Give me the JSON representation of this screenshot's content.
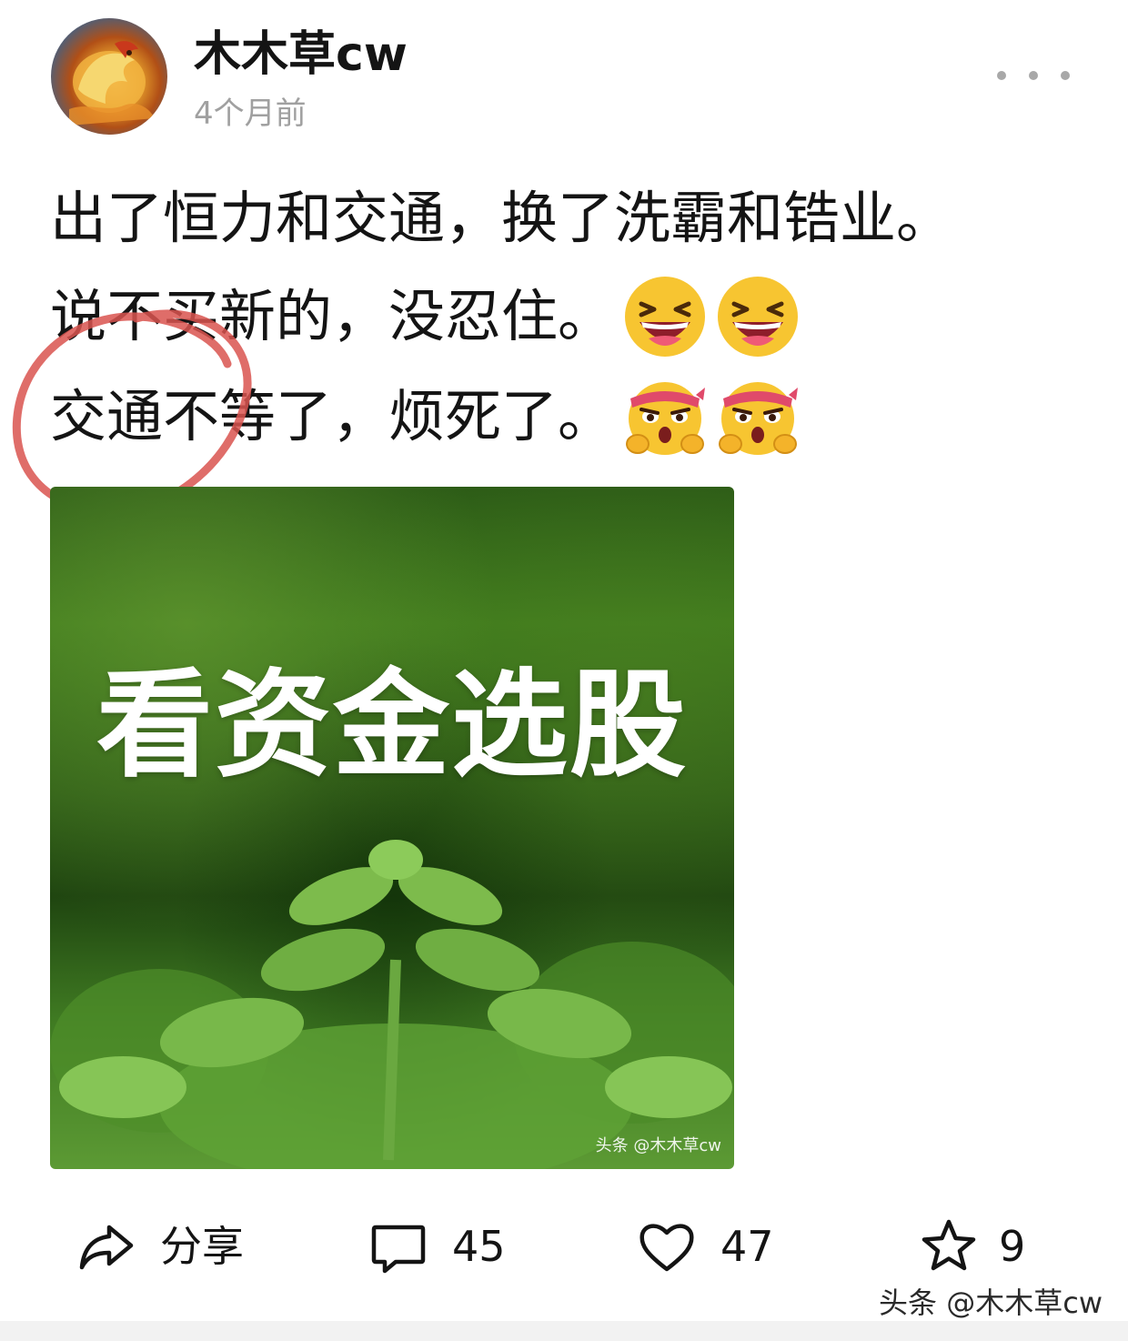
{
  "header": {
    "username": "木木草cw",
    "timestamp": "4个月前",
    "more_icon": "more-dots-icon"
  },
  "post": {
    "lines": [
      {
        "text": "出了恒力和交通，换了洗霸和锆业。",
        "emojis": []
      },
      {
        "text": "说不买新的，没忍住。",
        "emojis": [
          "laughing-emoji",
          "laughing-emoji"
        ]
      },
      {
        "text": "交通不等了，烦死了。",
        "emojis": [
          "fighting-emoji",
          "fighting-emoji"
        ]
      }
    ],
    "annotation_color": "#d9534f",
    "image": {
      "title": "看资金选股",
      "watermark": "头条 @木木草cw"
    }
  },
  "actions": {
    "share": {
      "label": "分享",
      "icon": "share-icon"
    },
    "comment": {
      "count": "45",
      "icon": "comment-icon"
    },
    "like": {
      "count": "47",
      "icon": "heart-icon"
    },
    "favorite": {
      "count": "9",
      "icon": "star-icon"
    }
  },
  "footer": {
    "watermark": "头条 @木木草cw"
  }
}
